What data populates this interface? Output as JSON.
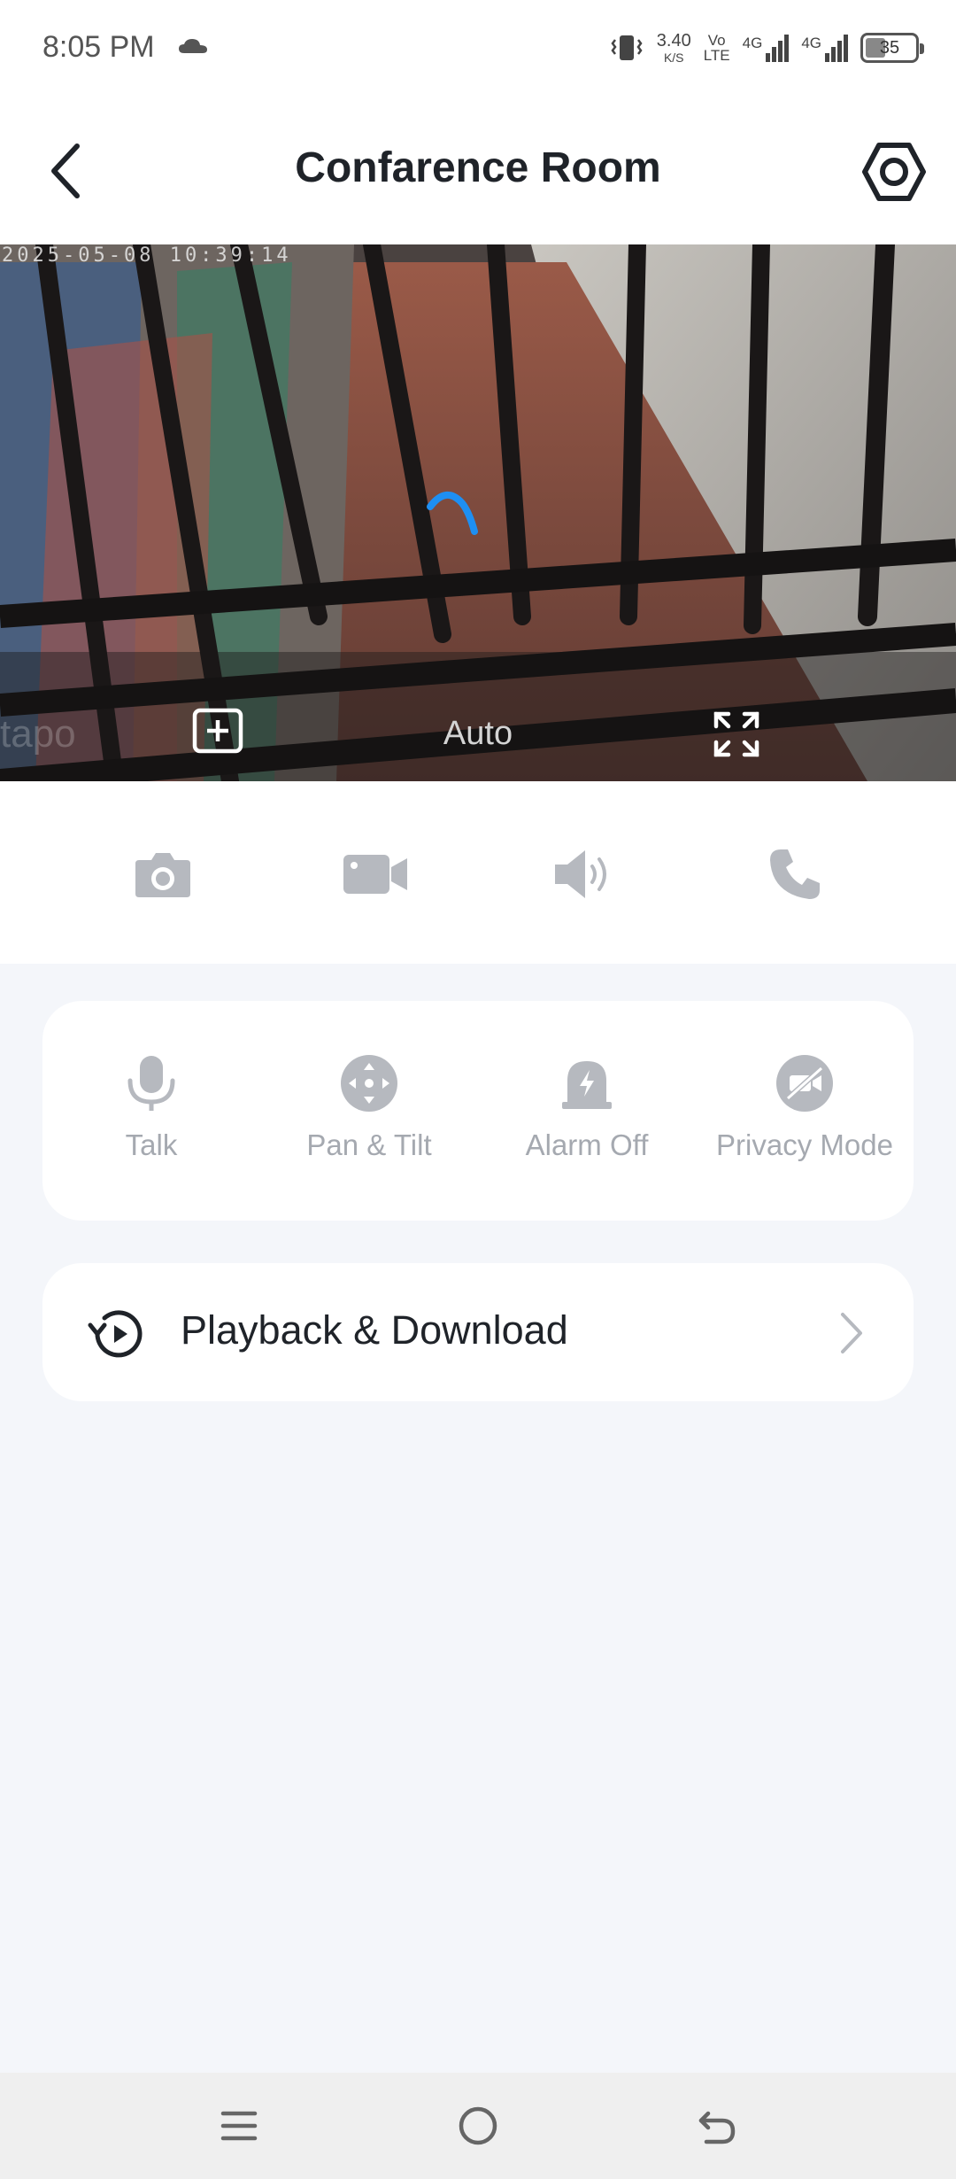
{
  "status_bar": {
    "time": "8:05 PM",
    "net_speed_value": "3.40",
    "net_speed_unit": "K/S",
    "volte_top": "Vo",
    "volte_bottom": "LTE",
    "sim1_label": "4G",
    "sim2_label": "4G",
    "battery": "35"
  },
  "header": {
    "title": "Confarence Room",
    "back_icon": "chevron-left-icon",
    "settings_icon": "hexagon-settings-icon"
  },
  "video": {
    "timestamp": "2025-05-08 10:39:14",
    "watermark": "tapo",
    "quality": "Auto",
    "loading_color": "#1e8ff2"
  },
  "toolbar": {
    "icons": [
      "camera-icon",
      "video-record-icon",
      "speaker-icon",
      "phone-call-icon"
    ]
  },
  "features": {
    "items": [
      {
        "label": "Talk",
        "icon": "microphone-icon"
      },
      {
        "label": "Pan & Tilt",
        "icon": "pan-tilt-icon"
      },
      {
        "label": "Alarm Off",
        "icon": "alarm-icon"
      },
      {
        "label": "Privacy Mode",
        "icon": "privacy-camera-off-icon"
      }
    ]
  },
  "playback": {
    "label": "Playback & Download",
    "icon": "history-play-icon"
  },
  "colors": {
    "accent": "#1e8ff2",
    "disabled_icon": "#b6b9bf",
    "background": "#f4f6fa"
  }
}
